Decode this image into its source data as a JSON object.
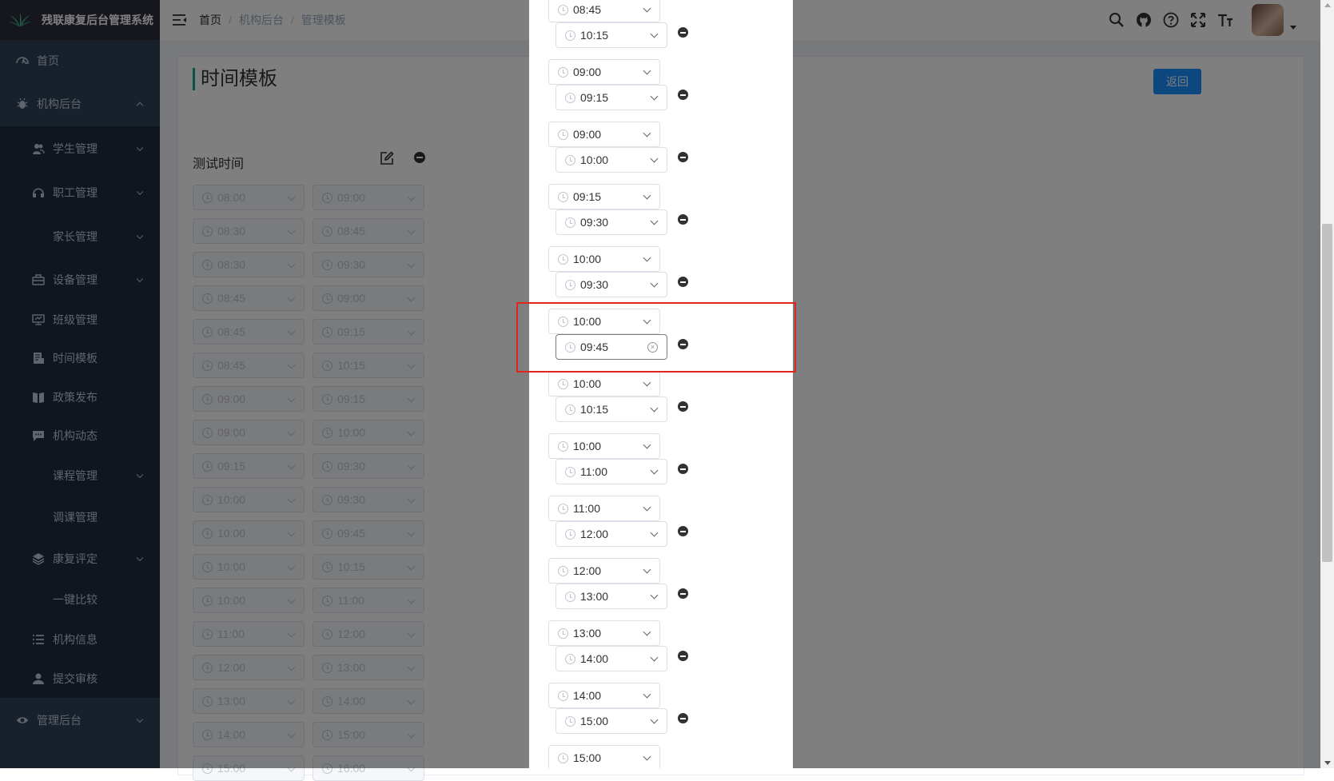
{
  "app": {
    "title": "残联康复后台管理系统"
  },
  "sidebar": {
    "items": [
      {
        "label": "首页",
        "icon": "dashboard-icon",
        "level": 1,
        "arrow": "none"
      },
      {
        "label": "机构后台",
        "icon": "bug-icon",
        "level": 1,
        "arrow": "up"
      },
      {
        "label": "学生管理",
        "icon": "peoples-icon",
        "level": 2,
        "arrow": "down"
      },
      {
        "label": "职工管理",
        "icon": "headset-icon",
        "level": 2,
        "arrow": "down"
      },
      {
        "label": "家长管理",
        "icon": "",
        "level": 2,
        "arrow": "down"
      },
      {
        "label": "设备管理",
        "icon": "toolbox-icon",
        "level": 2,
        "arrow": "down"
      },
      {
        "label": "班级管理",
        "icon": "monitor-icon",
        "level": 2,
        "arrow": "none"
      },
      {
        "label": "时间模板",
        "icon": "form-icon",
        "level": 2,
        "arrow": "none"
      },
      {
        "label": "政策发布",
        "icon": "book-icon",
        "level": 2,
        "arrow": "none"
      },
      {
        "label": "机构动态",
        "icon": "message-icon",
        "level": 2,
        "arrow": "none"
      },
      {
        "label": "课程管理",
        "icon": "",
        "level": 2,
        "arrow": "down"
      },
      {
        "label": "调课管理",
        "icon": "",
        "level": 2,
        "arrow": "none"
      },
      {
        "label": "康复评定",
        "icon": "layers-icon",
        "level": 2,
        "arrow": "down"
      },
      {
        "label": "一键比较",
        "icon": "",
        "level": 2,
        "arrow": "none"
      },
      {
        "label": "机构信息",
        "icon": "list-icon",
        "level": 2,
        "arrow": "none"
      },
      {
        "label": "提交审核",
        "icon": "user-icon",
        "level": 2,
        "arrow": "none"
      },
      {
        "label": "管理后台",
        "icon": "eye-icon",
        "level": 1,
        "arrow": "down"
      }
    ]
  },
  "breadcrumb": [
    "首页",
    "机构后台",
    "管理模板"
  ],
  "header_tools": [
    "search-icon",
    "github-icon",
    "question-icon",
    "fullscreen-icon",
    "font-size-icon"
  ],
  "page": {
    "title": "时间模板",
    "back_label": "返回",
    "template_name": "测试时间",
    "rows": [
      [
        "08:00",
        "09:00"
      ],
      [
        "08:30",
        "08:45"
      ],
      [
        "08:30",
        "09:30"
      ],
      [
        "08:45",
        "09:00"
      ],
      [
        "08:45",
        "09:15"
      ],
      [
        "08:45",
        "10:15"
      ],
      [
        "09:00",
        "09:15"
      ],
      [
        "09:00",
        "10:00"
      ],
      [
        "09:15",
        "09:30"
      ],
      [
        "10:00",
        "09:30"
      ],
      [
        "10:00",
        "09:45"
      ],
      [
        "10:00",
        "10:15"
      ],
      [
        "10:00",
        "11:00"
      ],
      [
        "11:00",
        "12:00"
      ],
      [
        "12:00",
        "13:00"
      ],
      [
        "13:00",
        "14:00"
      ],
      [
        "14:00",
        "15:00"
      ],
      [
        "15:00",
        "16:00"
      ]
    ]
  },
  "dialog": {
    "pairs": [
      [
        "08:45",
        "10:15"
      ],
      [
        "09:00",
        "09:15"
      ],
      [
        "09:00",
        "10:00"
      ],
      [
        "09:15",
        "09:30"
      ],
      [
        "10:00",
        "09:30"
      ],
      [
        "10:00",
        "09:45"
      ],
      [
        "10:00",
        "10:15"
      ],
      [
        "10:00",
        "11:00"
      ],
      [
        "11:00",
        "12:00"
      ],
      [
        "12:00",
        "13:00"
      ],
      [
        "13:00",
        "14:00"
      ],
      [
        "14:00",
        "15:00"
      ],
      [
        "15:00",
        ""
      ]
    ],
    "active_pair_index": 5
  },
  "colors": {
    "sidebar_bg": "#304156",
    "accent": "#1890ff",
    "title_bar": "#13a18c",
    "highlight": "#e0251b"
  }
}
